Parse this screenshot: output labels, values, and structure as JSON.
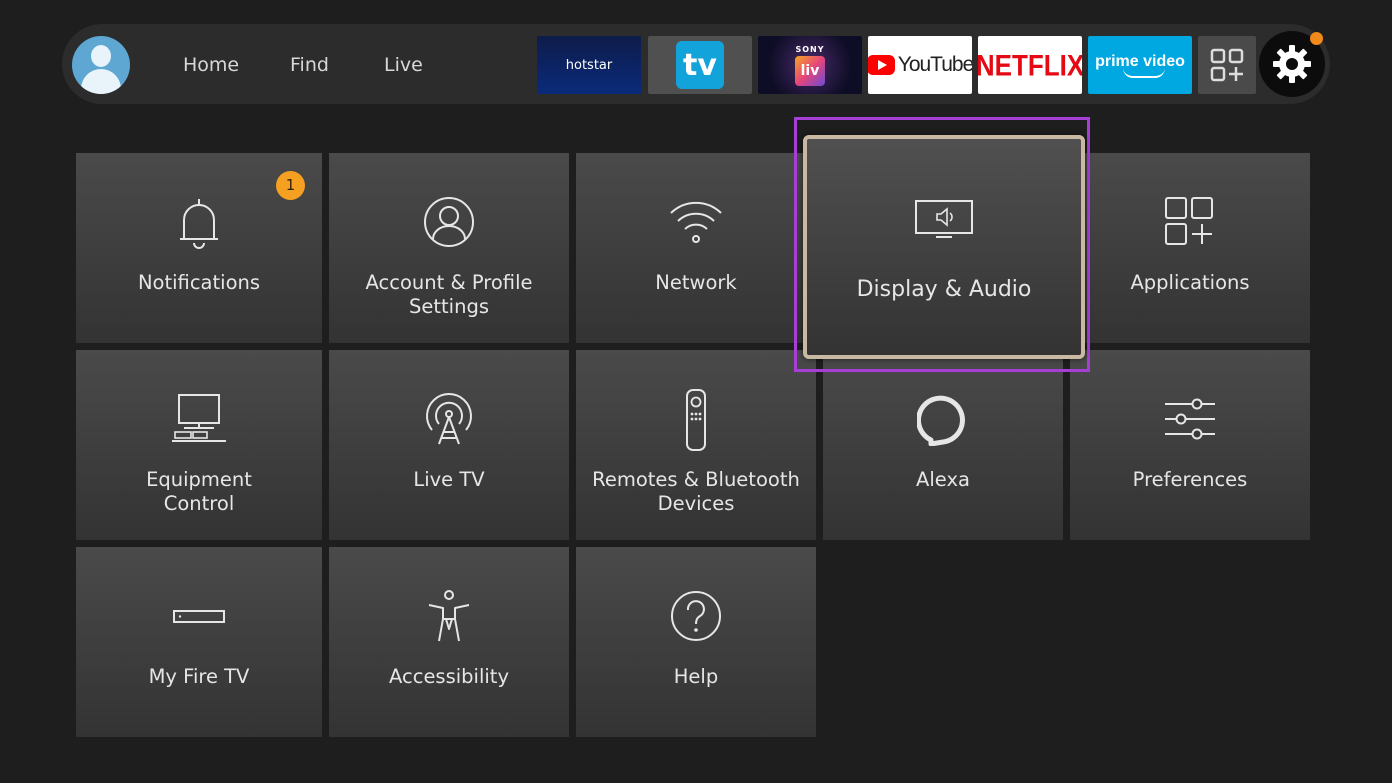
{
  "nav": {
    "items": [
      "Home",
      "Find",
      "Live"
    ]
  },
  "apps": {
    "hotstar": "hotstar",
    "tv": "tv",
    "sony_top": "SONY",
    "sony_liv": "liv",
    "youtube": "YouTube",
    "netflix": "NETFLIX",
    "prime": "prime video"
  },
  "settings": {
    "notifications": "Notifications",
    "notifications_badge": "1",
    "account_line1": "Account & Profile",
    "account_line2": "Settings",
    "network": "Network",
    "display_audio": "Display & Audio",
    "applications": "Applications",
    "equipment_line1": "Equipment",
    "equipment_line2": "Control",
    "live_tv": "Live TV",
    "remotes_line1": "Remotes & Bluetooth",
    "remotes_line2": "Devices",
    "alexa": "Alexa",
    "preferences": "Preferences",
    "my_fire_tv": "My Fire TV",
    "accessibility": "Accessibility",
    "help": "Help"
  },
  "colors": {
    "focus_outline": "#a63fd6",
    "badge": "#f5a020",
    "settings_dot": "#f28a1a"
  }
}
